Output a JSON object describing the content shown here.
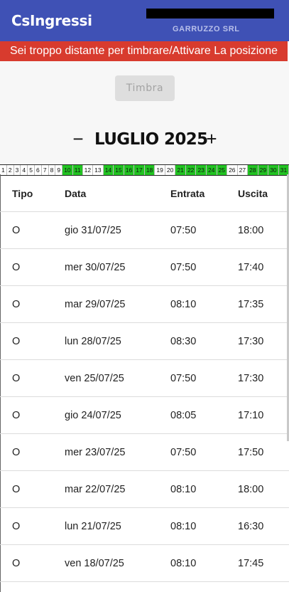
{
  "app": {
    "title": "CsIngressi",
    "company": "GARRUZZO SRL"
  },
  "banner": {
    "text": "Sei troppo distante per timbrare/Attivare La posizione"
  },
  "timbra": {
    "label": "Timbra",
    "enabled": false
  },
  "month_nav": {
    "prev": "−",
    "label": "LUGLIO 2025",
    "next": "+"
  },
  "colors": {
    "appbar": "#3f51b5",
    "banner": "#d83b2e",
    "day_ok": "#22c322"
  },
  "days": [
    {
      "n": "1",
      "ok": false
    },
    {
      "n": "2",
      "ok": false
    },
    {
      "n": "3",
      "ok": false
    },
    {
      "n": "4",
      "ok": false
    },
    {
      "n": "5",
      "ok": false
    },
    {
      "n": "6",
      "ok": false
    },
    {
      "n": "7",
      "ok": false
    },
    {
      "n": "8",
      "ok": false
    },
    {
      "n": "9",
      "ok": false
    },
    {
      "n": "10",
      "ok": true
    },
    {
      "n": "11",
      "ok": true
    },
    {
      "n": "12",
      "ok": false
    },
    {
      "n": "13",
      "ok": false
    },
    {
      "n": "14",
      "ok": true
    },
    {
      "n": "15",
      "ok": true
    },
    {
      "n": "16",
      "ok": true
    },
    {
      "n": "17",
      "ok": true
    },
    {
      "n": "18",
      "ok": true
    },
    {
      "n": "19",
      "ok": false
    },
    {
      "n": "20",
      "ok": false
    },
    {
      "n": "21",
      "ok": true
    },
    {
      "n": "22",
      "ok": true
    },
    {
      "n": "23",
      "ok": true
    },
    {
      "n": "24",
      "ok": true
    },
    {
      "n": "25",
      "ok": true
    },
    {
      "n": "26",
      "ok": false
    },
    {
      "n": "27",
      "ok": false
    },
    {
      "n": "28",
      "ok": true
    },
    {
      "n": "29",
      "ok": true
    },
    {
      "n": "30",
      "ok": true
    },
    {
      "n": "31",
      "ok": true
    }
  ],
  "table": {
    "headers": {
      "tipo": "Tipo",
      "data": "Data",
      "entrata": "Entrata",
      "uscita": "Uscita"
    },
    "rows": [
      {
        "tipo": "O",
        "data": "gio 31/07/25",
        "entrata": "07:50",
        "uscita": "18:00"
      },
      {
        "tipo": "O",
        "data": "mer 30/07/25",
        "entrata": "07:50",
        "uscita": "17:40"
      },
      {
        "tipo": "O",
        "data": "mar 29/07/25",
        "entrata": "08:10",
        "uscita": "17:35"
      },
      {
        "tipo": "O",
        "data": "lun 28/07/25",
        "entrata": "08:30",
        "uscita": "17:30"
      },
      {
        "tipo": "O",
        "data": "ven 25/07/25",
        "entrata": "07:50",
        "uscita": "17:30"
      },
      {
        "tipo": "O",
        "data": "gio 24/07/25",
        "entrata": "08:05",
        "uscita": "17:10"
      },
      {
        "tipo": "O",
        "data": "mer 23/07/25",
        "entrata": "07:50",
        "uscita": "17:50"
      },
      {
        "tipo": "O",
        "data": "mar 22/07/25",
        "entrata": "08:10",
        "uscita": "18:00"
      },
      {
        "tipo": "O",
        "data": "lun 21/07/25",
        "entrata": "08:10",
        "uscita": "16:30"
      },
      {
        "tipo": "O",
        "data": "ven 18/07/25",
        "entrata": "08:10",
        "uscita": "17:45"
      }
    ]
  }
}
